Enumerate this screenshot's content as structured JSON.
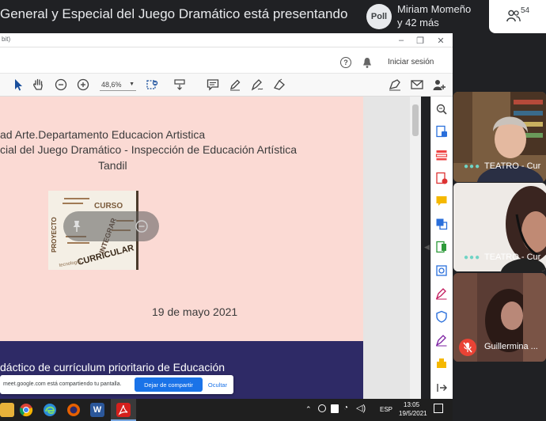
{
  "meet": {
    "presentation_title": "General y Especial del Juego Dramático está presentando",
    "presenter_avatar": "Poll",
    "presenter_name": "Miriam Momeño",
    "presenter_more": "y 42 más",
    "people_count": "54"
  },
  "window": {
    "title_fragment": "bit)",
    "minimize": "–",
    "maximize": "❐",
    "close": "✕"
  },
  "reader": {
    "signin": "Iniciar sesión",
    "help": "?",
    "zoom": "48,6%"
  },
  "slide": {
    "line1": "ad Arte.Departamento Educacion Artistica",
    "line2": "cial del Juego Dramático - Inspección de Educación Artística",
    "line3": "Tandil",
    "date": "19 de mayo  2021",
    "purple_text": "dáctico de currículum prioritario de Educación",
    "image_words": [
      "PROYECTO",
      "CURRICULAR",
      "CURSO",
      "INTEGRAR",
      "tecnología"
    ]
  },
  "sharebar": {
    "text": "meet.google.com está compartiendo tu pantalla.",
    "stop": "Dejar de compartir",
    "hide": "Ocultar"
  },
  "taskbar": {
    "lang": "ESP",
    "time": "13:05",
    "date": "19/5/2021"
  },
  "tiles": [
    {
      "label": "TEATRO - Cur"
    },
    {
      "label": "TEATRO - Cur"
    },
    {
      "label": "Guillermina ..."
    }
  ],
  "colors": {
    "meet_bg": "#202124",
    "slide_pink": "#fbdad4",
    "slide_purple": "#2e2a66",
    "accent_blue": "#1a73e8"
  }
}
